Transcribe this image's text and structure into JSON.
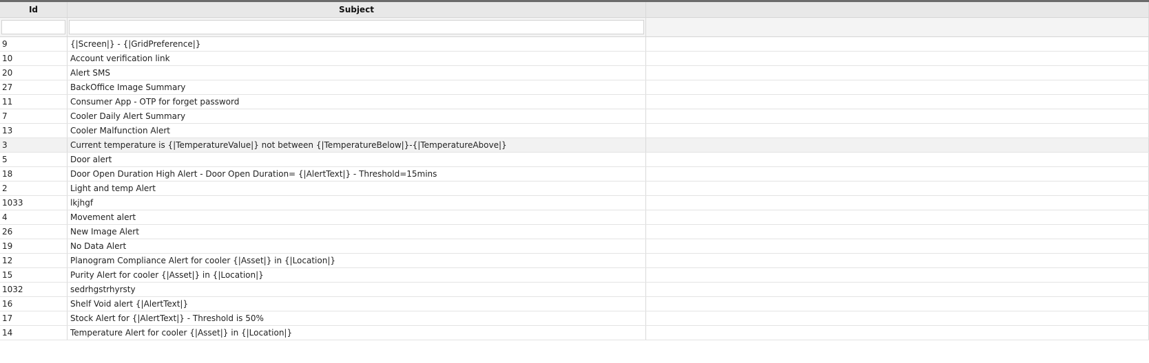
{
  "columns": {
    "id": "Id",
    "subject": "Subject"
  },
  "filters": {
    "id_value": "",
    "subject_value": ""
  },
  "rows": [
    {
      "id": "9",
      "subject": "{|Screen|} - {|GridPreference|}"
    },
    {
      "id": "10",
      "subject": "Account verification link"
    },
    {
      "id": "20",
      "subject": "Alert SMS"
    },
    {
      "id": "27",
      "subject": "BackOffice Image Summary"
    },
    {
      "id": "11",
      "subject": "Consumer App - OTP for forget password"
    },
    {
      "id": "7",
      "subject": "Cooler Daily Alert Summary"
    },
    {
      "id": "13",
      "subject": "Cooler Malfunction Alert"
    },
    {
      "id": "3",
      "subject": "Current temperature is {|TemperatureValue|} not between {|TemperatureBelow|}-{|TemperatureAbove|}"
    },
    {
      "id": "5",
      "subject": "Door alert"
    },
    {
      "id": "18",
      "subject": "Door Open Duration High Alert - Door Open Duration= {|AlertText|} - Threshold=15mins"
    },
    {
      "id": "2",
      "subject": "Light and temp Alert"
    },
    {
      "id": "1033",
      "subject": "lkjhgf"
    },
    {
      "id": "4",
      "subject": "Movement alert"
    },
    {
      "id": "26",
      "subject": "New Image Alert"
    },
    {
      "id": "19",
      "subject": "No Data Alert"
    },
    {
      "id": "12",
      "subject": "Planogram Compliance Alert for cooler {|Asset|} in {|Location|}"
    },
    {
      "id": "15",
      "subject": "Purity Alert for cooler {|Asset|} in {|Location|}"
    },
    {
      "id": "1032",
      "subject": "sedrhgstrhyrsty"
    },
    {
      "id": "16",
      "subject": "Shelf Void alert {|AlertText|}"
    },
    {
      "id": "17",
      "subject": "Stock Alert for {|AlertText|} - Threshold is 50%"
    },
    {
      "id": "14",
      "subject": "Temperature Alert for cooler {|Asset|} in {|Location|}"
    }
  ],
  "highlighted_row_index": 7,
  "colors": {
    "header_bg": "#e8e8e8",
    "top_border": "#6b6b6b",
    "row_highlight": "#f2f2f2"
  }
}
